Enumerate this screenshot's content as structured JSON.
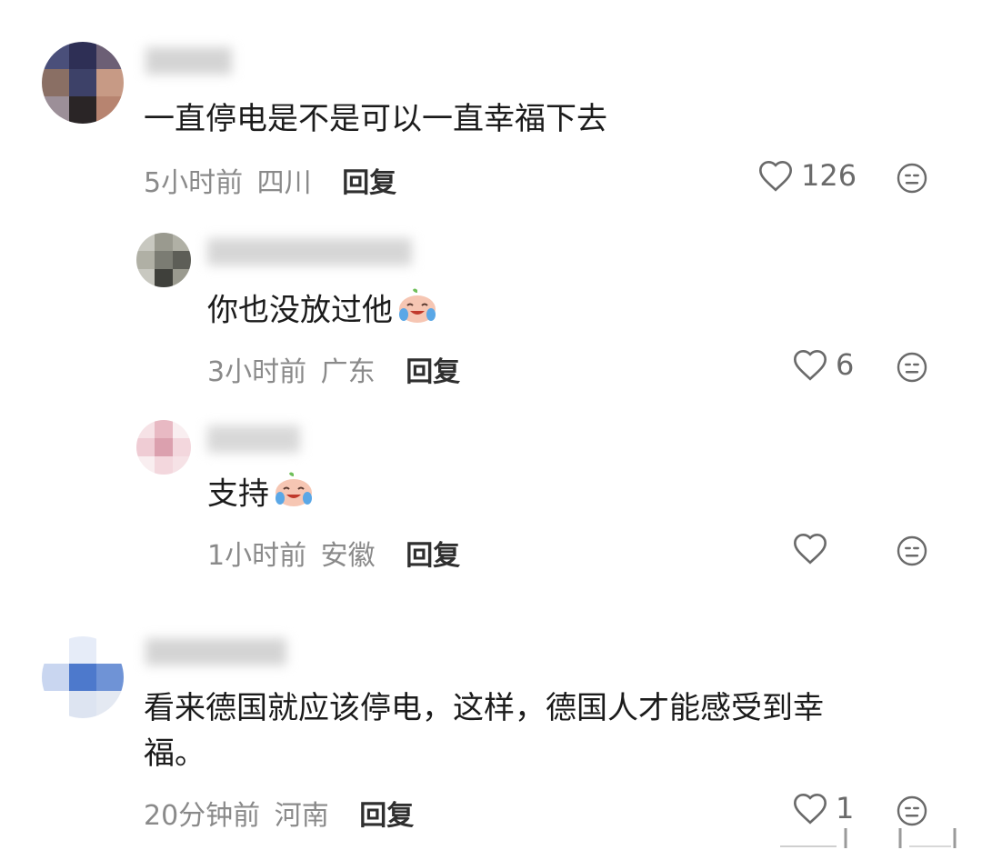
{
  "comments": [
    {
      "text": "一直停电是不是可以一直幸福下去",
      "time": "5小时前",
      "region": "四川",
      "reply": "回复",
      "likes": "126",
      "avatar_colors": [
        "#4a4f7a",
        "#2e2f55",
        "#6c5f75",
        "#3d4168",
        "#8a6f64",
        "#c79a85",
        "#5a4a55",
        "#b78470",
        "#2a2526",
        "#4b3a3c",
        "#9c8f98",
        "#6f6a80"
      ]
    },
    {
      "text": "你也没放过他",
      "time": "3小时前",
      "region": "广东",
      "reply": "回复",
      "likes": "6",
      "avatar_colors": [
        "#9a9a8f",
        "#5d5e57",
        "#c8c8c0",
        "#7b7c73",
        "#b0b0a5",
        "#3f403b"
      ]
    },
    {
      "text": "支持",
      "time": "1小时前",
      "region": "安徽",
      "reply": "回复",
      "likes": "",
      "avatar_colors": [
        "#f3d7dd",
        "#e8b9c3",
        "#f6e2e6",
        "#dba0ae",
        "#efccd4",
        "#f9eef0"
      ]
    },
    {
      "text_line1": "看来德国就应该停电，这样，德国人才能感受到幸",
      "text_line2": "福。",
      "time": "20分钟前",
      "region": "河南",
      "reply": "回复",
      "likes": "1",
      "avatar_colors": [
        "#e6ecf8",
        "#6f93d6",
        "#c9d6f0",
        "#4d79cc",
        "#e4e9f2",
        "#dde4f1"
      ]
    }
  ],
  "icons": {
    "like": "heart-outline-icon",
    "emoji_reaction": "neutral-face-icon",
    "inline_emoji": "crying-laughing-peach-emoji"
  },
  "colors": {
    "primary_text": "#1b1b1b",
    "meta_text": "#8a8a8a",
    "reply_text": "#2f2f2f",
    "icon": "#6a6a6a"
  }
}
